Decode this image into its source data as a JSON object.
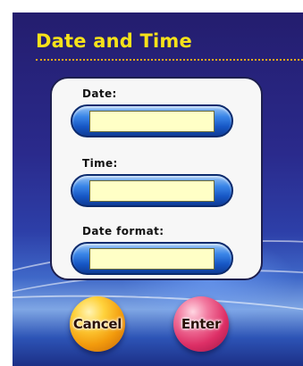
{
  "screen": {
    "title": "Date and Time"
  },
  "fields": [
    {
      "label": "Date:",
      "value": ""
    },
    {
      "label": "Time:",
      "value": ""
    },
    {
      "label": "Date format:",
      "value": ""
    }
  ],
  "buttons": {
    "cancel_label": "Cancel",
    "enter_label": "Enter"
  },
  "colors": {
    "title": "#f6e21a",
    "input_fill": "#ffffc6",
    "field_frame": "#1656c4",
    "cancel_button": "#f29a0c",
    "enter_button": "#dd2f66",
    "background": "#2a2a8c"
  }
}
